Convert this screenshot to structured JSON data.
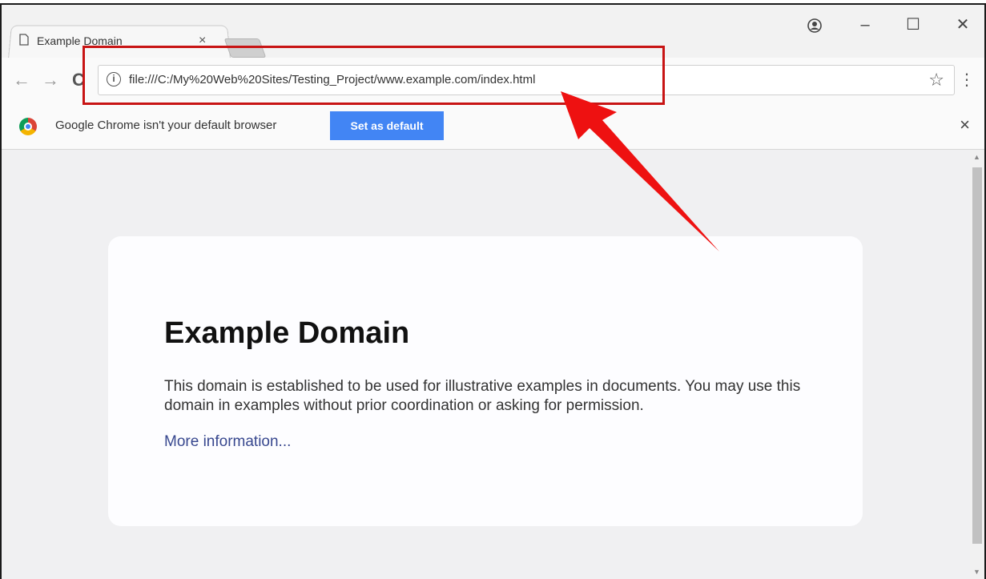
{
  "tab": {
    "title": "Example Domain",
    "close": "×"
  },
  "window_controls": {
    "profile": "👤",
    "minimize": "–",
    "maximize": "☐",
    "close": "✕"
  },
  "toolbar": {
    "back": "←",
    "forward": "→",
    "reload": "C",
    "url": "file:///C:/My%20Web%20Sites/Testing_Project/www.example.com/index.html",
    "info": "i",
    "star": "☆",
    "menu": "⋮"
  },
  "infobar": {
    "message": "Google Chrome isn't your default browser",
    "button": "Set as default",
    "close": "×"
  },
  "page": {
    "heading": "Example Domain",
    "body": "This domain is established to be used for illustrative examples in documents. You may use this domain in examples without prior coordination or asking for permission.",
    "link": "More information..."
  },
  "annotation": {
    "highlight_color": "#c81414",
    "arrow_color": "#ee1111"
  },
  "colors": {
    "button_blue": "#4285f4",
    "link": "#38488f"
  }
}
